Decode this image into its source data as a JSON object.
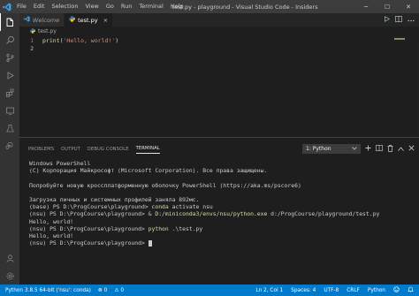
{
  "titlebar": {
    "menu": [
      "File",
      "Edit",
      "Selection",
      "View",
      "Go",
      "Run",
      "Terminal",
      "Help"
    ],
    "window_title": "test.py - playground - Visual Studio Code - Insiders",
    "minimize": "─",
    "maximize": "☐",
    "close": "✕"
  },
  "tabs": [
    {
      "label": "Welcome",
      "icon": "vscode-icon"
    },
    {
      "label": "test.py",
      "icon": "python-file-icon"
    }
  ],
  "tab_close": "×",
  "breadcrumb": {
    "file": "test.py"
  },
  "editor": {
    "lines": [
      {
        "num": "1",
        "fn": "print",
        "open": "(",
        "str": "'Hello, world!'",
        "close": ")"
      },
      {
        "num": "2"
      }
    ]
  },
  "panel": {
    "tabs": [
      "PROBLEMS",
      "OUTPUT",
      "DEBUG CONSOLE",
      "TERMINAL"
    ],
    "terminal_select": "1: Python",
    "terminal_lines": [
      "Windows PowerShell",
      "(C) Корпорация Майкрософт (Microsoft Corporation). Все права защищены.",
      "",
      "Попробуйте новую кроссплатформенную оболочку PowerShell (https://aka.ms/pscore6)",
      "",
      "Загрузка личных и системных профилей заняла 892мс."
    ],
    "cmd_lines": [
      {
        "prompt": "(base) PS D:\\ProgCourse\\playground> ",
        "cmd": "conda",
        "rest": " activate nsu"
      },
      {
        "prompt": "(nsu) PS D:\\ProgCourse\\playground> & ",
        "cmd": "D:/miniconda3/envs/nsu/python.exe",
        "rest": " d:/ProgCourse/playground/test.py"
      }
    ],
    "output1": "Hello, world!",
    "cmd3": {
      "prompt": "(nsu) PS D:\\ProgCourse\\playground> ",
      "cmd": "python",
      "rest": " .\\test.py"
    },
    "output2": "Hello, world!",
    "final_prompt": "(nsu) PS D:\\ProgCourse\\playground> "
  },
  "statusbar": {
    "python": "Python 3.8.5 64-bit ('nsu': conda)",
    "errors": "⊗ 0",
    "warnings": "⚠ 0",
    "position": "Ln 2, Col 1",
    "spaces": "Spaces: 4",
    "encoding": "UTF-8",
    "eol": "CRLF",
    "language": "Python"
  },
  "colors": {
    "statusbar": "#007acc",
    "titlebar": "#3c3c3c",
    "editor_bg": "#1e1e1e"
  }
}
